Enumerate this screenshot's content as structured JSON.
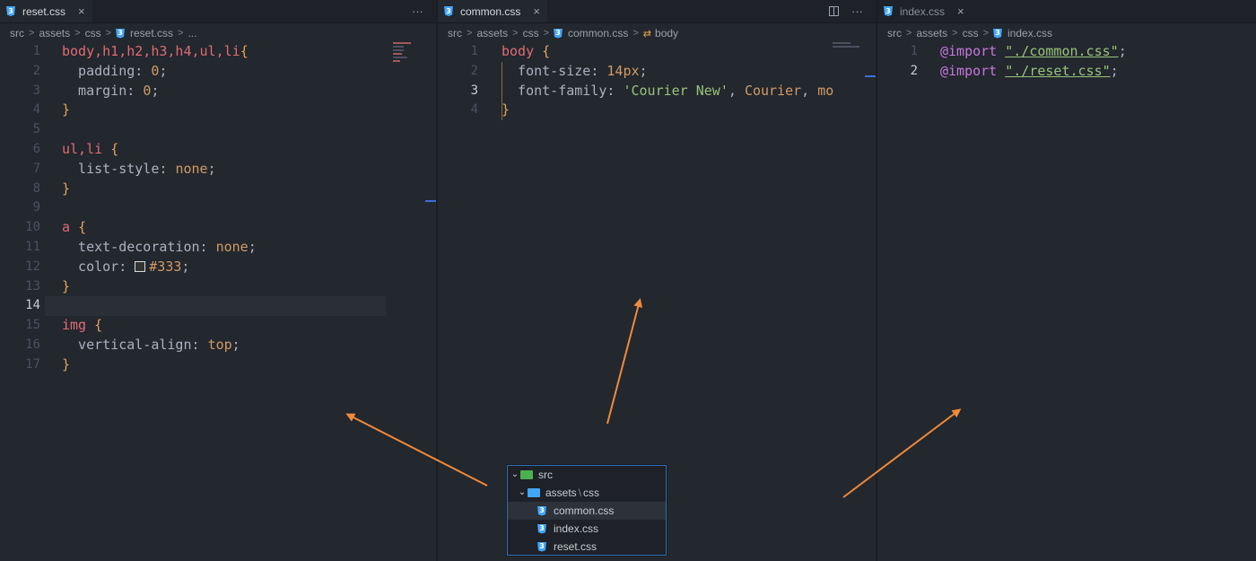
{
  "panes": {
    "left": {
      "tab_label": "reset.css",
      "tab_close": "×",
      "tab_more": "···",
      "breadcrumb": [
        "src",
        "assets",
        "css",
        "reset.css",
        "..."
      ],
      "lines": [
        {
          "n": "1",
          "tokens": [
            {
              "t": "body,h1,h2,h3,h4,ul,li",
              "c": "sel"
            },
            {
              "t": "{",
              "c": "brace"
            }
          ]
        },
        {
          "n": "2",
          "tokens": [
            {
              "t": "  padding: ",
              "c": "prop"
            },
            {
              "t": "0",
              "c": "num"
            },
            {
              "t": ";",
              "c": "pn"
            }
          ]
        },
        {
          "n": "3",
          "tokens": [
            {
              "t": "  margin: ",
              "c": "prop"
            },
            {
              "t": "0",
              "c": "num"
            },
            {
              "t": ";",
              "c": "pn"
            }
          ]
        },
        {
          "n": "4",
          "tokens": [
            {
              "t": "}",
              "c": "brace"
            }
          ]
        },
        {
          "n": "5",
          "tokens": []
        },
        {
          "n": "6",
          "tokens": [
            {
              "t": "ul,li ",
              "c": "sel"
            },
            {
              "t": "{",
              "c": "brace"
            }
          ]
        },
        {
          "n": "7",
          "tokens": [
            {
              "t": "  list-style: ",
              "c": "prop"
            },
            {
              "t": "none",
              "c": "num"
            },
            {
              "t": ";",
              "c": "pn"
            }
          ]
        },
        {
          "n": "8",
          "tokens": [
            {
              "t": "}",
              "c": "brace"
            }
          ]
        },
        {
          "n": "9",
          "tokens": []
        },
        {
          "n": "10",
          "tokens": [
            {
              "t": "a ",
              "c": "sel"
            },
            {
              "t": "{",
              "c": "brace"
            }
          ]
        },
        {
          "n": "11",
          "tokens": [
            {
              "t": "  text-decoration: ",
              "c": "prop"
            },
            {
              "t": "none",
              "c": "num"
            },
            {
              "t": ";",
              "c": "pn"
            }
          ]
        },
        {
          "n": "12",
          "tokens": [
            {
              "t": "  color: ",
              "c": "prop"
            },
            {
              "t": "",
              "c": "swatch"
            },
            {
              "t": "#333",
              "c": "num"
            },
            {
              "t": ";",
              "c": "pn"
            }
          ]
        },
        {
          "n": "13",
          "tokens": [
            {
              "t": "}",
              "c": "brace"
            }
          ]
        },
        {
          "n": "14",
          "tokens": [],
          "current": true
        },
        {
          "n": "15",
          "tokens": [
            {
              "t": "img ",
              "c": "sel"
            },
            {
              "t": "{",
              "c": "brace"
            }
          ]
        },
        {
          "n": "16",
          "tokens": [
            {
              "t": "  vertical-align: ",
              "c": "prop"
            },
            {
              "t": "top",
              "c": "num"
            },
            {
              "t": ";",
              "c": "pn"
            }
          ]
        },
        {
          "n": "17",
          "tokens": [
            {
              "t": "}",
              "c": "brace"
            }
          ]
        }
      ]
    },
    "middle": {
      "tab_label": "common.css",
      "tab_close": "×",
      "tab_more": "···",
      "breadcrumb": [
        "src",
        "assets",
        "css",
        "common.css"
      ],
      "breadcrumb_symbol": "body",
      "lines": [
        {
          "n": "1",
          "tokens": [
            {
              "t": "body ",
              "c": "sel"
            },
            {
              "t": "{",
              "c": "brace"
            }
          ]
        },
        {
          "n": "2",
          "tokens": [
            {
              "t": "  font-size: ",
              "c": "prop"
            },
            {
              "t": "14px",
              "c": "num"
            },
            {
              "t": ";",
              "c": "pn"
            }
          ]
        },
        {
          "n": "3",
          "tokens": [
            {
              "t": "  font-family: ",
              "c": "prop"
            },
            {
              "t": "'Courier New'",
              "c": "str"
            },
            {
              "t": ", ",
              "c": "pn"
            },
            {
              "t": "Courier",
              "c": "num"
            },
            {
              "t": ", ",
              "c": "pn"
            },
            {
              "t": "mo",
              "c": "num"
            }
          ],
          "current": true
        },
        {
          "n": "4",
          "tokens": [
            {
              "t": "}",
              "c": "brace"
            }
          ]
        }
      ]
    },
    "right": {
      "tab_label": "index.css",
      "tab_close": "×",
      "breadcrumb": [
        "src",
        "assets",
        "css",
        "index.css"
      ],
      "lines": [
        {
          "n": "1",
          "tokens": [
            {
              "t": "@import ",
              "c": "kw"
            },
            {
              "t": "\"./common.css\"",
              "c": "str link"
            },
            {
              "t": ";",
              "c": "pn"
            }
          ]
        },
        {
          "n": "2",
          "tokens": [
            {
              "t": "@import ",
              "c": "kw"
            },
            {
              "t": "\"./reset.css\"",
              "c": "str link"
            },
            {
              "t": ";",
              "c": "pn"
            }
          ],
          "current": true
        }
      ]
    }
  },
  "explorer": {
    "root": "src",
    "folder": "assets",
    "folder_sep": "\\",
    "subfolder": "css",
    "files": [
      "common.css",
      "index.css",
      "reset.css"
    ],
    "selected": "common.css"
  },
  "icons": {
    "css_file": "css-file-icon",
    "folder": "folder-icon",
    "chevron": "chevron-right-icon",
    "close": "close-icon",
    "more": "more-actions-icon",
    "split": "split-editor-icon"
  },
  "colors": {
    "arrow": "#f08a3a",
    "selector": "#e06c75",
    "string": "#98c379",
    "keyword": "#c678dd",
    "number": "#d19a66",
    "css_icon": "#42a5f5"
  }
}
